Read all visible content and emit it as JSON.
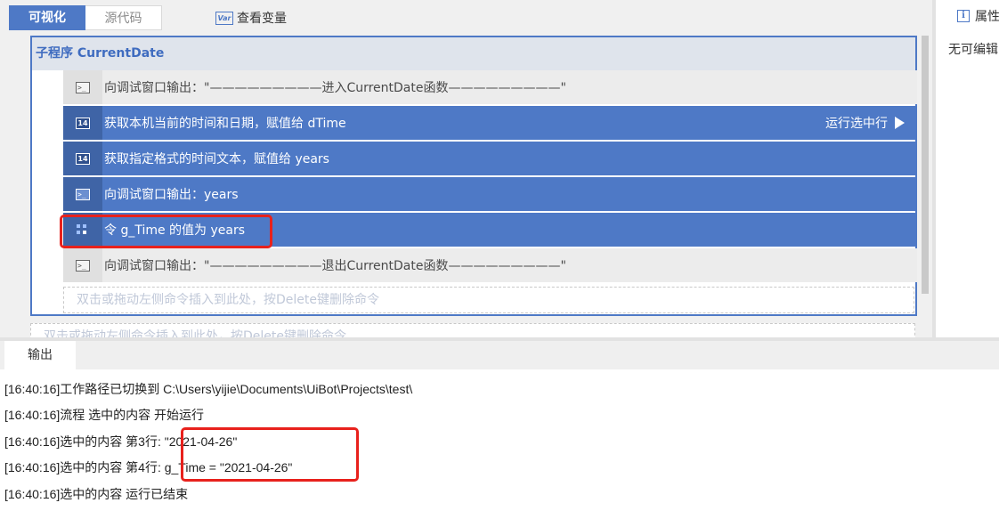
{
  "tabs": {
    "visual": "可视化",
    "source": "源代码"
  },
  "toolbar": {
    "view_variables": "查看变量",
    "var_icon_text": "Var"
  },
  "subprogram": {
    "title": "子程序 CurrentDate"
  },
  "commands": [
    {
      "icon": "console",
      "text": "向调试窗口输出：\"—————————进入CurrentDate函数—————————\"",
      "selected": false
    },
    {
      "icon": "calendar",
      "icon_text": "14",
      "text": "获取本机当前的时间和日期，赋值给 dTime",
      "selected": true,
      "run_label": "运行选中行"
    },
    {
      "icon": "calendar",
      "icon_text": "14",
      "text": "获取指定格式的时间文本，赋值给 years",
      "selected": true
    },
    {
      "icon": "console",
      "text": "向调试窗口输出：years",
      "selected": true
    },
    {
      "icon": "assign",
      "text": "令 g_Time 的值为 years",
      "selected": true
    },
    {
      "icon": "console",
      "text": "向调试窗口输出：\"—————————退出CurrentDate函数—————————\"",
      "selected": false
    }
  ],
  "drop_hint": "双击或拖动左侧命令插入到此处，按Delete键删除命令",
  "properties": {
    "tab_label": "属性",
    "empty_text": "无可编辑"
  },
  "output": {
    "tab_label": "输出",
    "lines": [
      "[16:40:16]工作路径已切换到 C:\\Users\\yijie\\Documents\\UiBot\\Projects\\test\\",
      "[16:40:16]流程 选中的内容 开始运行",
      "[16:40:16]选中的内容 第3行: \"2021-04-26\"",
      "[16:40:16]选中的内容 第4行: g_Time = \"2021-04-26\"",
      "[16:40:16]选中的内容 运行已结束"
    ]
  },
  "colors": {
    "accent": "#4e79c6",
    "highlight": "#e8211c"
  }
}
